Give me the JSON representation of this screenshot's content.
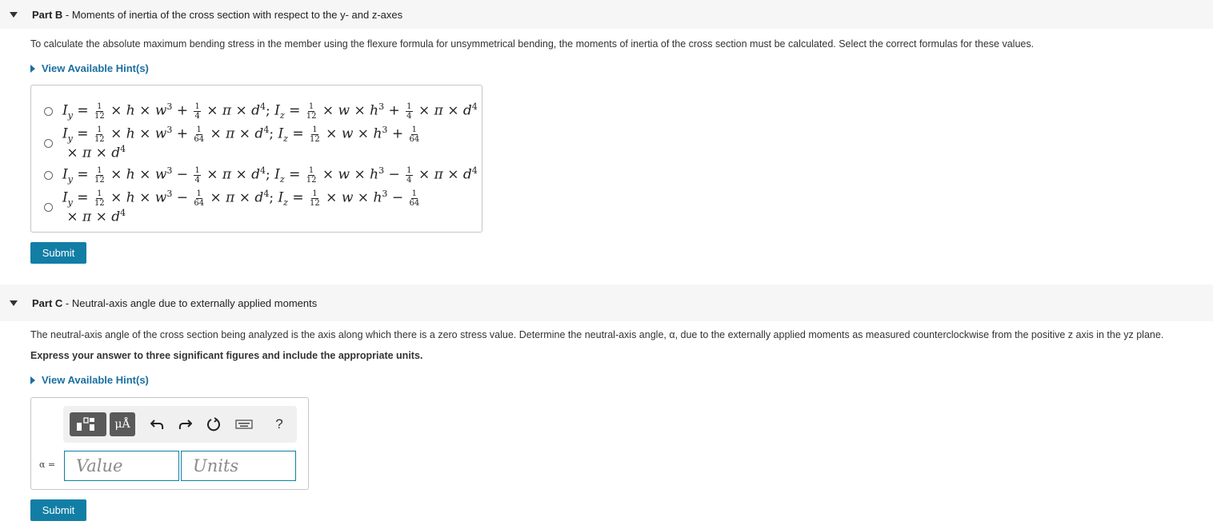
{
  "partB": {
    "label": "Part B",
    "title": " - Moments of inertia of the cross section with respect to the y- and z-axes",
    "instruction": "To calculate the absolute maximum bending stress in the member using the flexure formula for unsymmetrical bending, the moments of inertia of the cross section must be calculated. Select the correct formulas for these values.",
    "hint_label": "View Available Hint(s)",
    "options": [
      {
        "op1": "+",
        "f2": "4",
        "op2": "+",
        "f4": "4"
      },
      {
        "op1": "+",
        "f2": "64",
        "op2": "+",
        "f4": "64"
      },
      {
        "op1": "−",
        "f2": "4",
        "op2": "−",
        "f4": "4"
      },
      {
        "op1": "−",
        "f2": "64",
        "op2": "−",
        "f4": "64"
      }
    ],
    "submit_label": "Submit"
  },
  "partC": {
    "label": "Part C",
    "title": " - Neutral-axis angle due to externally applied moments",
    "instruction": "The neutral-axis angle of the cross section being analyzed is the axis along which there is a zero stress value. Determine the neutral-axis angle, α, due to the externally applied moments as measured counterclockwise from the positive z axis in the yz plane.",
    "emphasis": "Express your answer to three significant figures and include the appropriate units.",
    "hint_label": "View Available Hint(s)",
    "toolbar": {
      "units_label": "μÅ",
      "help_label": "?"
    },
    "answer_label": "α =",
    "value_placeholder": "Value",
    "units_placeholder": "Units",
    "submit_label": "Submit"
  },
  "icons": [
    "expand-triangle-icon",
    "hint-arrow-icon",
    "templates-icon",
    "units-icon",
    "undo-icon",
    "redo-icon",
    "reset-icon",
    "keyboard-icon",
    "help-icon"
  ],
  "colors": {
    "accent": "#127ea5",
    "link": "#1a6fa1",
    "header_bg": "#f6f6f6"
  }
}
